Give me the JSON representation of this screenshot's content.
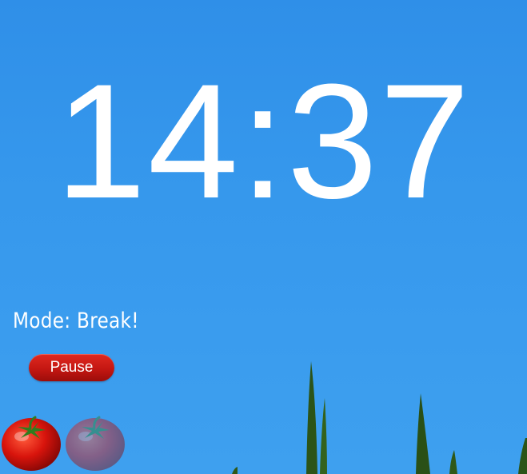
{
  "timer": {
    "display": "14:37"
  },
  "mode": {
    "text": "Mode: Break!"
  },
  "controls": {
    "pause_label": "Pause"
  },
  "pomodoros": [
    {
      "icon": "tomato-icon",
      "state": "completed"
    },
    {
      "icon": "tomato-icon",
      "state": "pending"
    }
  ],
  "colors": {
    "sky": "#3597ec",
    "text": "#ffffff",
    "button": "#c41712",
    "tomato": "#d8140c",
    "stem": "#2f7d1e",
    "grass": "#2c5a18"
  }
}
